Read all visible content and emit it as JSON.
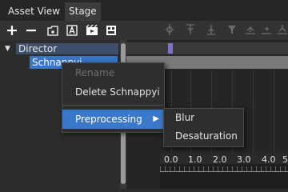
{
  "tabs": [
    {
      "label": "Asset View"
    },
    {
      "label": "Stage"
    }
  ],
  "toolbar": {
    "add_glyph": "+",
    "remove_glyph": "−"
  },
  "tree": {
    "root_label": "Director",
    "child_label": "Schnappyi"
  },
  "context_menu": {
    "rename": "Rename",
    "delete": "Delete Schnappyi",
    "preprocessing": "Preprocessing",
    "submenu": [
      "Blur",
      "Desaturation"
    ]
  },
  "ruler": {
    "ticks": [
      "0.0",
      "1.0",
      "2.0",
      "3.0",
      "4.0",
      "5"
    ]
  },
  "colors": {
    "selection": "#3876c8",
    "menu_highlight": "#3a78cc",
    "clip_marker": "#7f73c9"
  }
}
